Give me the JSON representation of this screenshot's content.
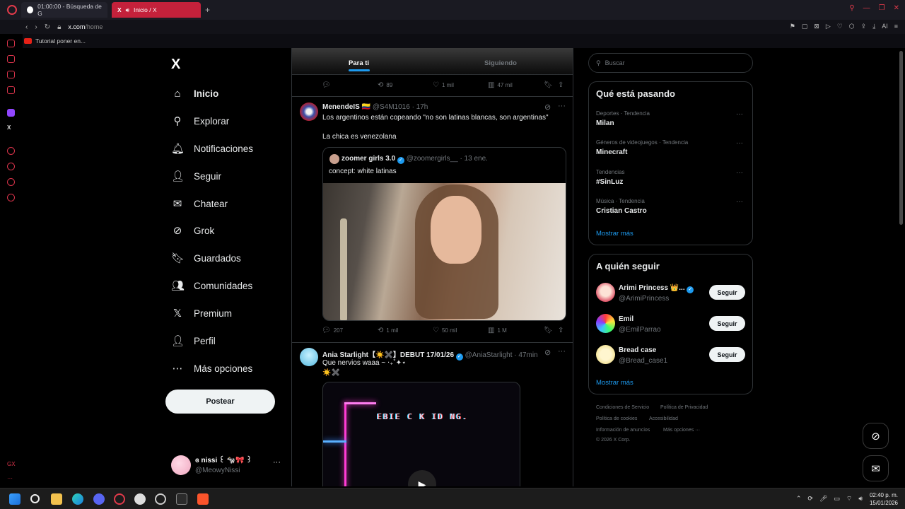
{
  "browser": {
    "tabs": [
      {
        "label": "01:00:00 - Búsqueda de G",
        "active": false
      },
      {
        "label": "Inicio / X",
        "active": true
      }
    ],
    "new_tab": "+",
    "url_host": "x.com",
    "url_path": "/home",
    "bookmark": "Tutorial poner en...",
    "accent": "#c4213b"
  },
  "nav": {
    "logo": "X",
    "items": [
      {
        "label": "Inicio",
        "icon": "home-icon",
        "glyph": "⌂"
      },
      {
        "label": "Explorar",
        "icon": "search-icon",
        "glyph": "⚲"
      },
      {
        "label": "Notificaciones",
        "icon": "bell-icon",
        "glyph": "🔔︎"
      },
      {
        "label": "Seguir",
        "icon": "add-person-icon",
        "glyph": "👤︎"
      },
      {
        "label": "Chatear",
        "icon": "mail-icon",
        "glyph": "✉"
      },
      {
        "label": "Grok",
        "icon": "grok-icon",
        "glyph": "⊘"
      },
      {
        "label": "Guardados",
        "icon": "bookmark-icon",
        "glyph": "🔖︎"
      },
      {
        "label": "Comunidades",
        "icon": "communities-icon",
        "glyph": "👥︎"
      },
      {
        "label": "Premium",
        "icon": "x-premium-icon",
        "glyph": "𝕏"
      },
      {
        "label": "Perfil",
        "icon": "profile-icon",
        "glyph": "👤︎"
      },
      {
        "label": "Más opciones",
        "icon": "more-circle-icon",
        "glyph": "⋯"
      }
    ],
    "post_button": "Postear",
    "account": {
      "name": "ɞ nissi ꒰ 🐄🎀 ꒱",
      "handle": "@MeowyNissi",
      "more": "···"
    }
  },
  "timeline": {
    "tabs": [
      "Para ti",
      "Siguiendo"
    ],
    "prev_actions": {
      "replies": "",
      "reposts": "89",
      "likes": "1 mil",
      "views": "47 mil"
    },
    "tweet1": {
      "name": "MenendeIS 🇨🇴",
      "handle": "@S4M1016",
      "time": "· 17h",
      "line1": "Los argentinos están copeando \"no son latinas blancas, son argentinas\"",
      "line2": "La chica es venezolana",
      "quote": {
        "name": "zoomer girls 3.0",
        "handle": "@zoomergirls__",
        "time": "· 13 ene.",
        "text": "concept: white latinas"
      },
      "actions": {
        "replies": "207",
        "reposts": "1 mil",
        "likes": "50 mil",
        "views": "1 M"
      }
    },
    "tweet2": {
      "name": "Ania Starlight【☀️✖️】DEBUT 17/01/26",
      "handle": "@AniaStarlight",
      "time": "· 47min",
      "line1": "Que nervios waaa ~ ‧₊˚✦⋆",
      "line2": "☀️✖️",
      "video_text": "EBIE C K ID NG."
    }
  },
  "right": {
    "search_placeholder": "Buscar",
    "trends_title": "Qué está pasando",
    "trends": [
      {
        "meta": "Deportes · Tendencia",
        "name": "Milan"
      },
      {
        "meta": "Géneros de videojuegos · Tendencia",
        "name": "Minecraft"
      },
      {
        "meta": "Tendencias",
        "name": "#SinLuz"
      },
      {
        "meta": "Música · Tendencia",
        "name": "Cristian Castro"
      }
    ],
    "show_more": "Mostrar más",
    "wtf_title": "A quién seguir",
    "wtf": [
      {
        "name": "Arimi Princess 👑...",
        "handle": "@ArimiPrincess",
        "button": "Seguir"
      },
      {
        "name": "Emil",
        "handle": "@EmilParrao",
        "button": "Seguir"
      },
      {
        "name": "Bread case",
        "handle": "@Bread_case1",
        "button": "Seguir"
      }
    ],
    "wtf_show_more": "Mostrar más",
    "footer": [
      "Condiciones de Servicio",
      "Política de Privacidad",
      "Política de cookies",
      "Accesibilidad",
      "Información de anuncios",
      "Más opciones ···",
      "© 2026 X Corp."
    ]
  },
  "taskbar": {
    "time": "02:40 p. m.",
    "date": "15/01/2026"
  }
}
